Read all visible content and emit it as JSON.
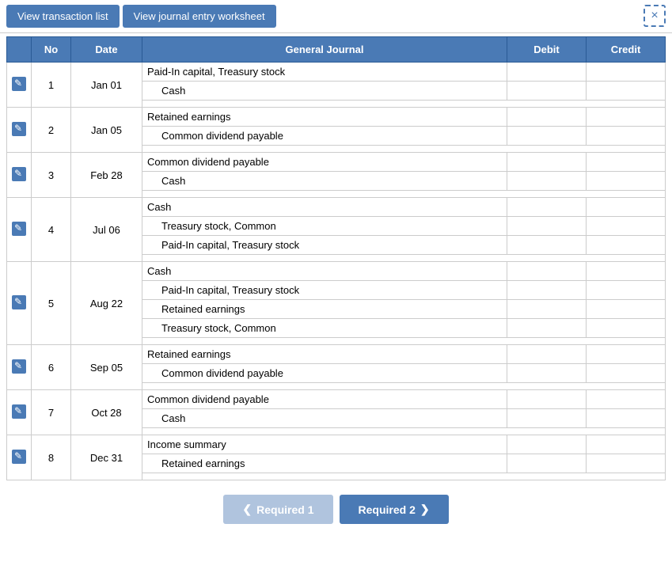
{
  "topbar": {
    "btn_transaction": "View transaction list",
    "btn_worksheet": "View journal entry worksheet",
    "close_icon": "×"
  },
  "table": {
    "headers": [
      "",
      "No",
      "Date",
      "General Journal",
      "Debit",
      "Credit"
    ],
    "rows": [
      {
        "no": "1",
        "date": "Jan 01",
        "entries": [
          {
            "account": "Paid-In capital, Treasury stock",
            "debit": "",
            "credit": ""
          },
          {
            "account": "Cash",
            "debit": "",
            "credit": ""
          }
        ]
      },
      {
        "no": "2",
        "date": "Jan 05",
        "entries": [
          {
            "account": "Retained earnings",
            "debit": "",
            "credit": ""
          },
          {
            "account": "Common dividend payable",
            "debit": "",
            "credit": ""
          }
        ]
      },
      {
        "no": "3",
        "date": "Feb 28",
        "entries": [
          {
            "account": "Common dividend payable",
            "debit": "",
            "credit": ""
          },
          {
            "account": "Cash",
            "debit": "",
            "credit": ""
          }
        ]
      },
      {
        "no": "4",
        "date": "Jul 06",
        "entries": [
          {
            "account": "Cash",
            "debit": "",
            "credit": ""
          },
          {
            "account": "Treasury stock, Common",
            "debit": "",
            "credit": ""
          },
          {
            "account": "Paid-In capital, Treasury stock",
            "debit": "",
            "credit": ""
          }
        ]
      },
      {
        "no": "5",
        "date": "Aug 22",
        "entries": [
          {
            "account": "Cash",
            "debit": "",
            "credit": ""
          },
          {
            "account": "Paid-In capital, Treasury stock",
            "debit": "",
            "credit": ""
          },
          {
            "account": "Retained earnings",
            "debit": "",
            "credit": ""
          },
          {
            "account": "Treasury stock, Common",
            "debit": "",
            "credit": ""
          }
        ]
      },
      {
        "no": "6",
        "date": "Sep 05",
        "entries": [
          {
            "account": "Retained earnings",
            "debit": "",
            "credit": ""
          },
          {
            "account": "Common dividend payable",
            "debit": "",
            "credit": ""
          }
        ]
      },
      {
        "no": "7",
        "date": "Oct 28",
        "entries": [
          {
            "account": "Common dividend payable",
            "debit": "",
            "credit": ""
          },
          {
            "account": "Cash",
            "debit": "",
            "credit": ""
          }
        ]
      },
      {
        "no": "8",
        "date": "Dec 31",
        "entries": [
          {
            "account": "Income summary",
            "debit": "",
            "credit": ""
          },
          {
            "account": "Retained earnings",
            "debit": "",
            "credit": ""
          }
        ]
      }
    ]
  },
  "footer": {
    "required1_label": "Required 1",
    "required2_label": "Required 2",
    "prev_chevron": "❮",
    "next_chevron": "❯"
  }
}
